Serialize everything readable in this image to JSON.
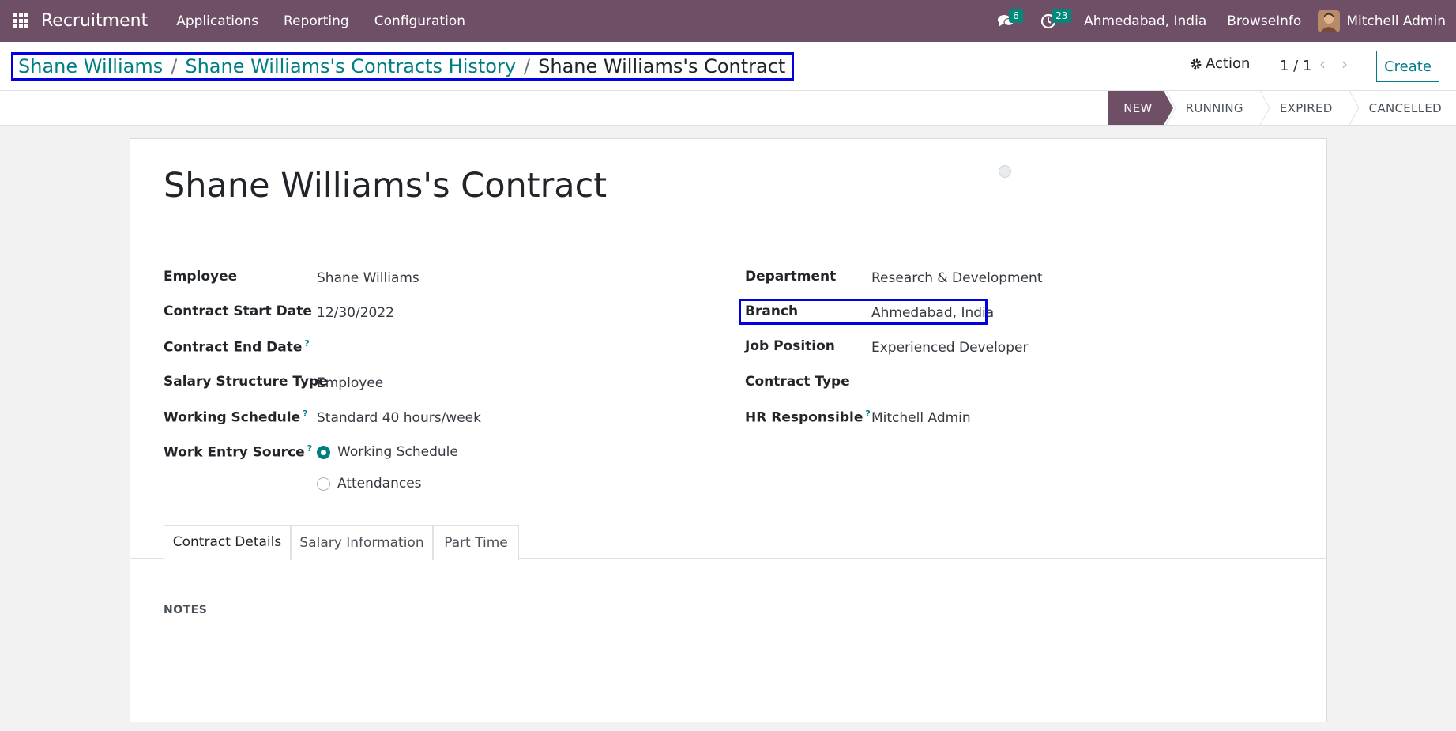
{
  "navbar": {
    "app_name": "Recruitment",
    "menu": [
      "Applications",
      "Reporting",
      "Configuration"
    ],
    "messages_badge": "6",
    "activities_badge": "23",
    "company": "Ahmedabad, India",
    "database": "BrowseInfo",
    "user": "Mitchell Admin"
  },
  "breadcrumb": {
    "items": [
      "Shane Williams",
      "Shane Williams's Contracts History"
    ],
    "current": "Shane Williams's Contract",
    "separator": "/"
  },
  "control": {
    "action_label": "Action",
    "pager": "1 / 1",
    "create_label": "Create"
  },
  "statusbar": {
    "stages": [
      "NEW",
      "RUNNING",
      "EXPIRED",
      "CANCELLED"
    ],
    "active": "NEW"
  },
  "form": {
    "title": "Shane Williams's Contract",
    "left": {
      "employee_label": "Employee",
      "employee_value": "Shane Williams",
      "start_label": "Contract Start Date",
      "start_value": "12/30/2022",
      "end_label": "Contract End Date",
      "salary_struct_label": "Salary Structure Type",
      "salary_struct_value": "Employee",
      "schedule_label": "Working Schedule",
      "schedule_value": "Standard 40 hours/week",
      "work_entry_label": "Work Entry Source",
      "work_entry_options": [
        "Working Schedule",
        "Attendances"
      ]
    },
    "right": {
      "department_label": "Department",
      "department_value": "Research & Development",
      "branch_label": "Branch",
      "branch_value": "Ahmedabad, India",
      "job_label": "Job Position",
      "job_value": "Experienced Developer",
      "contract_type_label": "Contract Type",
      "hr_label": "HR Responsible",
      "hr_value": "Mitchell Admin"
    },
    "help_mark": "?",
    "tabs": [
      "Contract Details",
      "Salary Information",
      "Part Time"
    ],
    "notes_label": "NOTES"
  },
  "colors": {
    "navbar": "#6e4f66",
    "accent": "#017e84",
    "highlight_box": "#0000e0"
  }
}
